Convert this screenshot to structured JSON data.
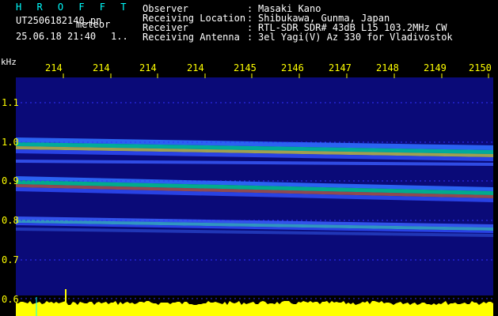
{
  "header": {
    "title": "H R O F F T",
    "filename": "UT2506182140.pn",
    "file_tag": "meteor",
    "datetime": "25.06.18 21:40",
    "datetime_suffix": "1.."
  },
  "info": [
    {
      "label": "Observer",
      "value": "Masaki Kano"
    },
    {
      "label": "Receiving Location",
      "value": "Shibukawa, Gunma, Japan"
    },
    {
      "label": "Receiver",
      "value": "RTL-SDR SDR# 43dB L15 103.2MHz CW"
    },
    {
      "label": "Receiving Antenna",
      "value": "3el Yagi(V) Az 330 for Vladivostok"
    }
  ],
  "axis": {
    "unit": "kHz",
    "time_ticks": [
      "214",
      "214",
      "214",
      "214",
      "2145",
      "2146",
      "2147",
      "2148",
      "2149",
      "2150"
    ],
    "freq_ticks": [
      "1.1",
      "1.0",
      "0.9",
      "0.8",
      "0.7",
      "0.6"
    ]
  },
  "colors": {
    "background": "#000000",
    "waterfall": "#0a0a78",
    "text_cyan": "#00ffff",
    "tick_yellow": "#ffff00",
    "grid_blue": "#3030ff",
    "signal_yellow": "#ffff00"
  }
}
